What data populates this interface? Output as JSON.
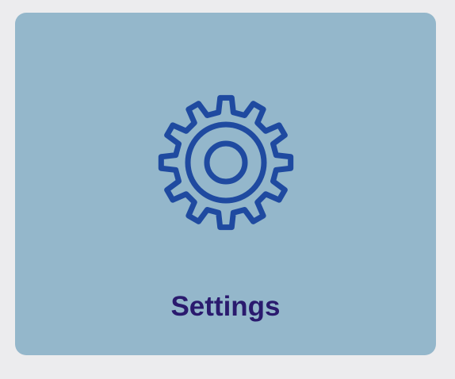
{
  "tile": {
    "label": "Settings",
    "icon": "gear-icon"
  },
  "colors": {
    "page_background": "#ececee",
    "tile_background": "#94b7cb",
    "icon_stroke": "#1f4aa0",
    "label_color": "#2a1a6e"
  }
}
